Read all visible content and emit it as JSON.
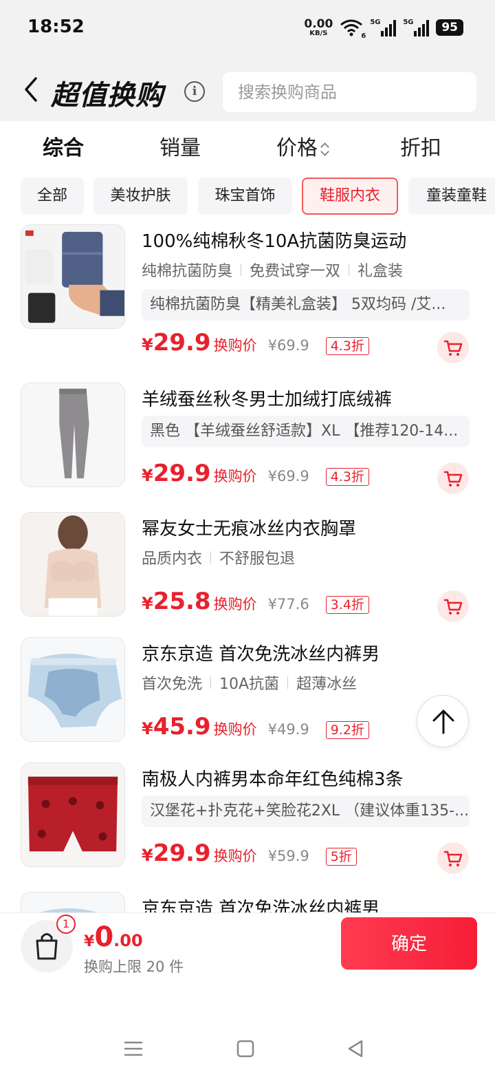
{
  "status_bar": {
    "time": "18:52",
    "net_speed": "0.00",
    "net_unit": "KB/S",
    "wifi_sub": "6",
    "signal1_label": "5G",
    "signal2_label": "5G",
    "battery": "95"
  },
  "header": {
    "title": "超值换购",
    "search_placeholder": "搜索换购商品"
  },
  "sort_tabs": [
    "综合",
    "销量",
    "价格",
    "折扣"
  ],
  "categories": [
    "全部",
    "美妆护肤",
    "珠宝首饰",
    "鞋服内衣",
    "童装童鞋"
  ],
  "selected_category": "鞋服内衣",
  "products": [
    {
      "title": "100%纯棉秋冬10A抗菌防臭运动",
      "tags": [
        "纯棉抗菌防臭",
        "免费试穿一双",
        "礼盒装"
      ],
      "spec": "纯棉抗菌防臭【精美礼盒装】 5双均码 /艾...",
      "price": "29.9",
      "price_label": "换购价",
      "original_price": "¥69.9",
      "discount": "4.3折",
      "image_icon": "socks-icon"
    },
    {
      "title": "羊绒蚕丝秋冬男士加绒打底绒裤",
      "tags": [],
      "spec": "黑色 【羊绒蚕丝舒适款】XL 【推荐120-14...",
      "price": "29.9",
      "price_label": "换购价",
      "original_price": "¥69.9",
      "discount": "4.3折",
      "image_icon": "long-johns-icon"
    },
    {
      "title": "幂友女士无痕冰丝内衣胸罩",
      "tags": [
        "品质内衣",
        "不舒服包退"
      ],
      "spec": "",
      "price": "25.8",
      "price_label": "换购价",
      "original_price": "¥77.6",
      "discount": "3.4折",
      "image_icon": "bra-icon"
    },
    {
      "title": "京东京造 首次免洗冰丝内裤男",
      "tags": [
        "首次免洗",
        "10A抗菌",
        "超薄冰丝"
      ],
      "spec": "",
      "price": "45.9",
      "price_label": "换购价",
      "original_price": "¥49.9",
      "discount": "9.2折",
      "image_icon": "briefs-icon"
    },
    {
      "title": "南极人内裤男本命年红色纯棉3条",
      "tags": [],
      "spec": "汉堡花+扑克花+笑脸花2XL （建议体重135-...",
      "price": "29.9",
      "price_label": "换购价",
      "original_price": "¥59.9",
      "discount": "5折",
      "image_icon": "red-boxers-icon"
    },
    {
      "title": "京东京造 首次免洗冰丝内裤男",
      "tags": [],
      "spec": "",
      "price": "",
      "price_label": "",
      "original_price": "",
      "discount": "",
      "image_icon": "briefs-icon"
    }
  ],
  "currency": "¥",
  "bottom_bar": {
    "badge_count": "1",
    "total_yen": "¥",
    "total_int": "0",
    "total_dec": ".00",
    "limit_text": "换购上限 20 件",
    "confirm_label": "确定"
  },
  "colors": {
    "accent": "#e8212d",
    "confirm_gradient_start": "#ff3b52",
    "confirm_gradient_end": "#f51e36",
    "header_bg": "#f2f2f2"
  }
}
